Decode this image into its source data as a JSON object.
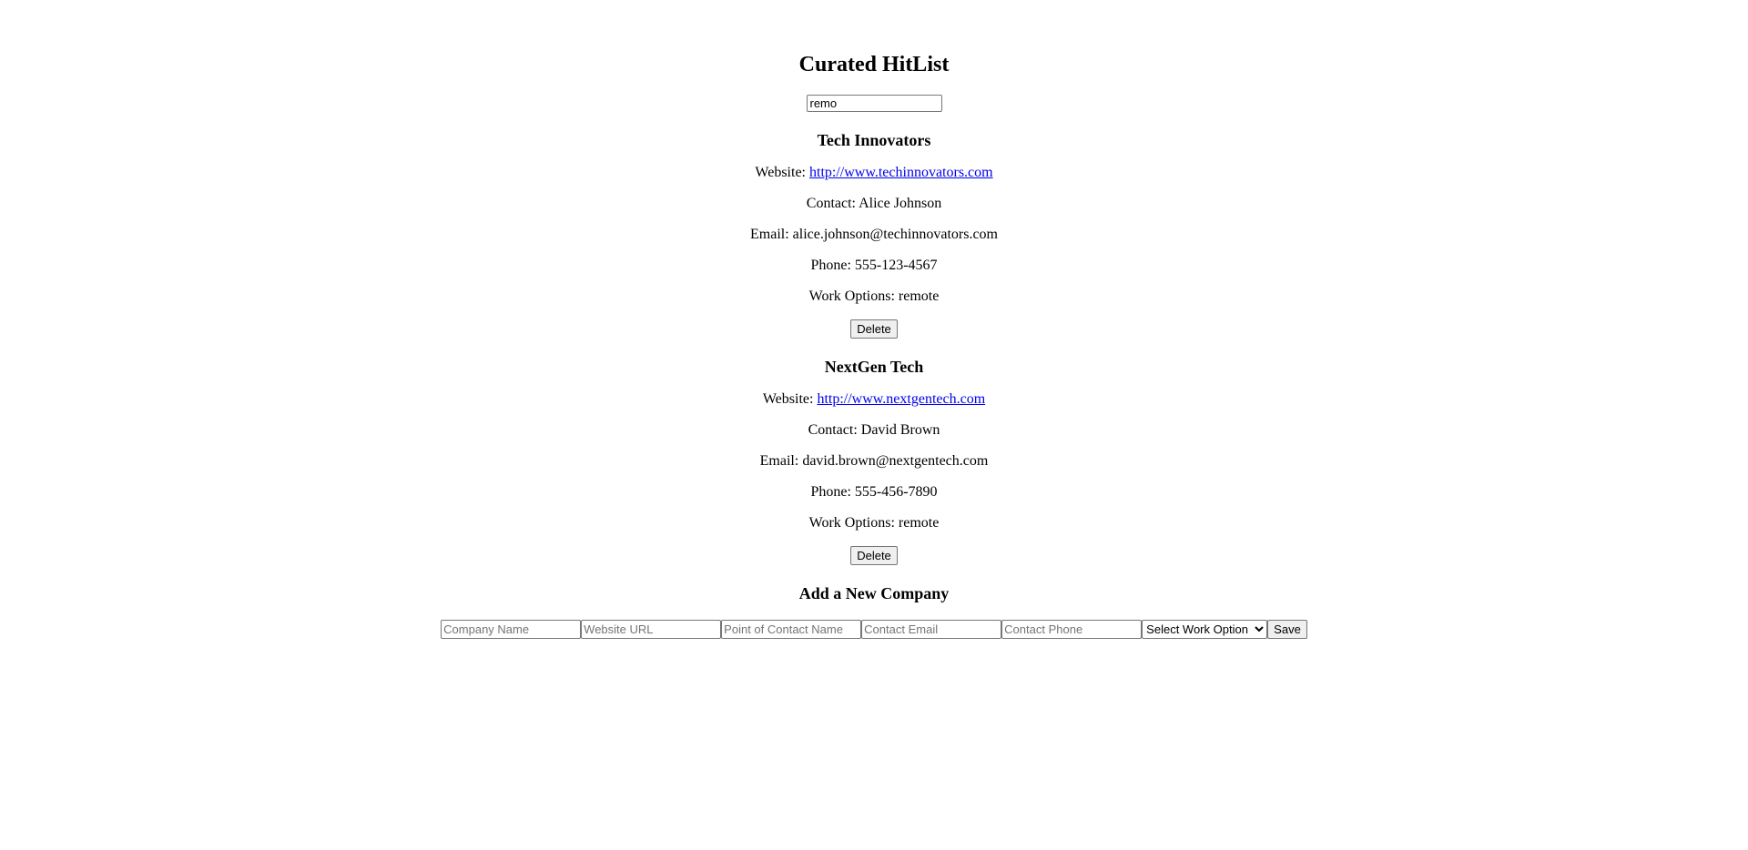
{
  "page": {
    "title": "Curated HitList"
  },
  "search": {
    "value": "remo"
  },
  "companies": [
    {
      "name": "Tech Innovators",
      "website_label": "Website: ",
      "website": "http://www.techinnovators.com",
      "contact": "Contact: Alice Johnson",
      "email": "Email: alice.johnson@techinnovators.com",
      "phone": "Phone: 555-123-4567",
      "work_options": "Work Options: remote",
      "delete_label": "Delete"
    },
    {
      "name": "NextGen Tech",
      "website_label": "Website: ",
      "website": "http://www.nextgentech.com",
      "contact": "Contact: David Brown",
      "email": "Email: david.brown@nextgentech.com",
      "phone": "Phone: 555-456-7890",
      "work_options": "Work Options: remote",
      "delete_label": "Delete"
    }
  ],
  "add_form": {
    "heading": "Add a New Company",
    "company_name_placeholder": "Company Name",
    "website_placeholder": "Website URL",
    "contact_name_placeholder": "Point of Contact Name",
    "email_placeholder": "Contact Email",
    "phone_placeholder": "Contact Phone",
    "work_option_selected": "Select Work Option",
    "save_label": "Save"
  }
}
